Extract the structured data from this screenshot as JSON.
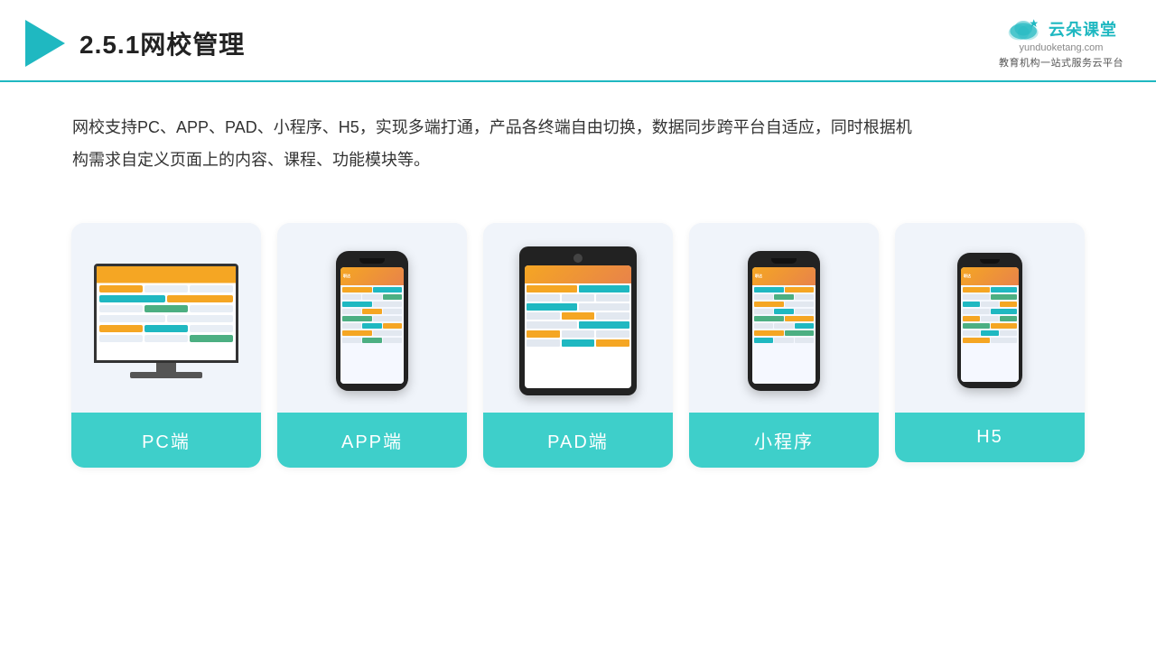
{
  "header": {
    "title": "2.5.1网校管理",
    "brand_name": "云朵课堂",
    "brand_url": "yunduoketang.com",
    "brand_tagline": "教育机构一站式服务云平台"
  },
  "description": {
    "text": "网校支持PC、APP、PAD、小程序、H5，实现多端打通，产品各终端自由切换，数据同步跨平台自适应，同时根据机构需求自定义页面上的内容、课程、功能模块等。"
  },
  "cards": [
    {
      "id": "pc",
      "label": "PC端"
    },
    {
      "id": "app",
      "label": "APP端"
    },
    {
      "id": "pad",
      "label": "PAD端"
    },
    {
      "id": "miniapp",
      "label": "小程序"
    },
    {
      "id": "h5",
      "label": "H5"
    }
  ],
  "colors": {
    "teal": "#3ecfca",
    "accent": "#1fb8c1",
    "triangle": "#1fb8c1"
  }
}
